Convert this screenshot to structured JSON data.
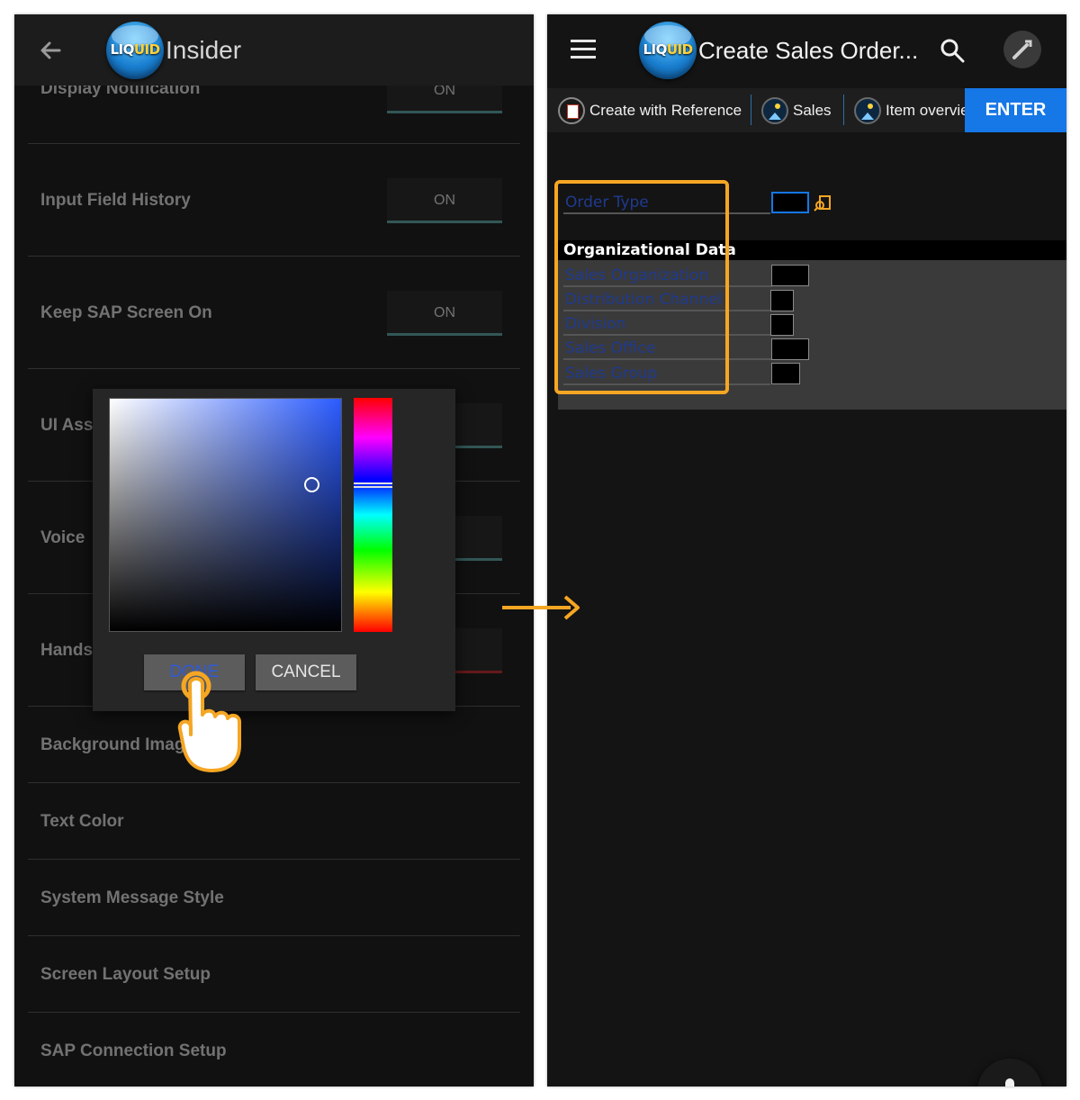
{
  "left_screen": {
    "app_title": "Insider",
    "logo": {
      "text_main": "LIQ",
      "text_accent": "UID"
    },
    "settings": [
      {
        "label": "Display Notification",
        "value": "ON"
      },
      {
        "label": "Input Field History",
        "value": "ON"
      },
      {
        "label": "Keep SAP Screen On",
        "value": "ON"
      },
      {
        "label": "UI Ass",
        "value": ""
      },
      {
        "label": "Voice ",
        "value": ""
      },
      {
        "label": "Hands",
        "value": ""
      },
      {
        "label": "Background Image",
        "value": ""
      },
      {
        "label": "Text Color",
        "value": ""
      },
      {
        "label": "System Message Style",
        "value": ""
      },
      {
        "label": "Screen Layout Setup",
        "value": ""
      },
      {
        "label": "SAP Connection Setup",
        "value": ""
      }
    ],
    "color_picker": {
      "done_label": "DONE",
      "cancel_label": "CANCEL",
      "selected_color": "#1f3a8f"
    }
  },
  "right_screen": {
    "app_title": "Create Sales Order...",
    "logo": {
      "text_main": "LIQ",
      "text_accent": "UID"
    },
    "toolbar": {
      "create_with_reference": "Create with Reference",
      "sales": "Sales",
      "item_overview": "Item overvie",
      "enter": "ENTER"
    },
    "form": {
      "order_type_label": "Order Type",
      "section_header": "Organizational Data",
      "fields": [
        {
          "label": "Sales Organization",
          "value": ""
        },
        {
          "label": "Distribution Channel",
          "value": ""
        },
        {
          "label": "Division",
          "value": ""
        },
        {
          "label": "Sales Office",
          "value": ""
        },
        {
          "label": "Sales Group",
          "value": ""
        }
      ]
    }
  },
  "colors": {
    "highlight": "#f5a623",
    "accent_blue": "#1677e6",
    "field_label_blue": "#1f3a8f"
  }
}
